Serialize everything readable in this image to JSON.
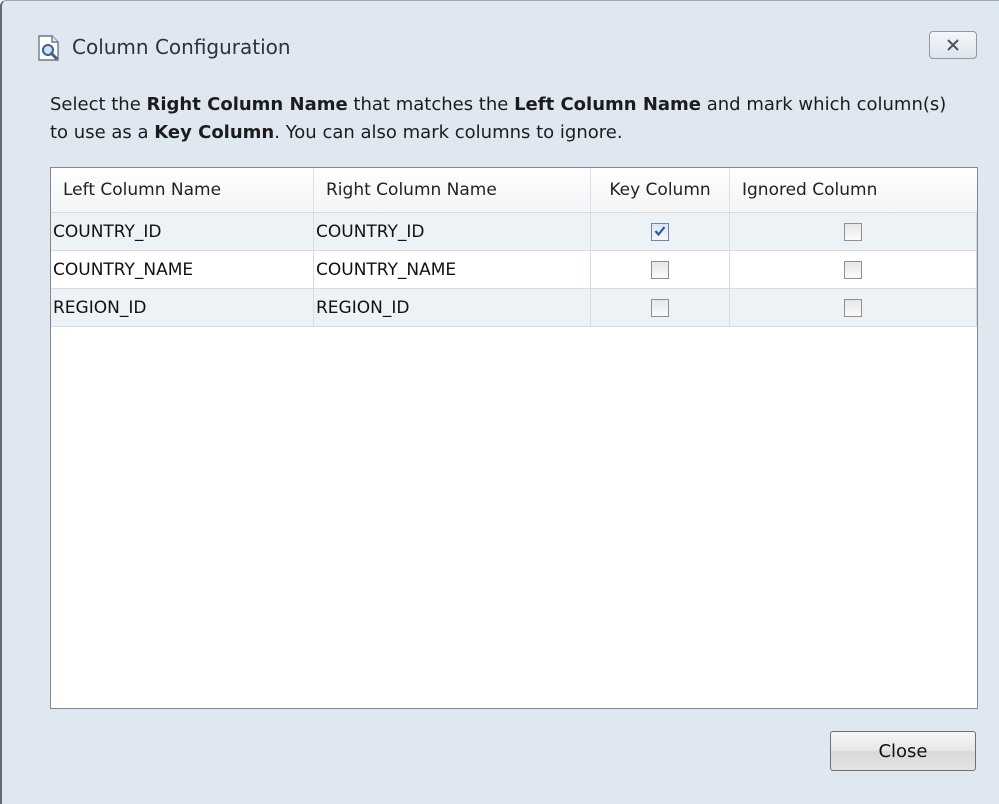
{
  "window": {
    "title": "Column Configuration",
    "title_icon": "document-search-icon",
    "close_icon": "close-x-icon"
  },
  "instructions": {
    "p1": "Select the ",
    "b1": "Right Column Name",
    "p2": " that matches the ",
    "b2": "Left Column Name",
    "p3": " and mark which column(s) to use as a ",
    "b3": "Key Column",
    "p4": ". You can also mark columns to ignore."
  },
  "table": {
    "headers": [
      "Left Column Name",
      "Right Column Name",
      "Key Column",
      "Ignored Column"
    ],
    "rows": [
      {
        "left": "COUNTRY_ID",
        "right": "COUNTRY_ID",
        "key": true,
        "ignored": false
      },
      {
        "left": "COUNTRY_NAME",
        "right": "COUNTRY_NAME",
        "key": false,
        "ignored": false
      },
      {
        "left": "REGION_ID",
        "right": "REGION_ID",
        "key": false,
        "ignored": false
      }
    ]
  },
  "footer": {
    "close_label": "Close"
  },
  "colors": {
    "dialog_bg": "#dfe7f1",
    "row_alt": "#edf2f7",
    "check_mark": "#2d5c9e"
  }
}
